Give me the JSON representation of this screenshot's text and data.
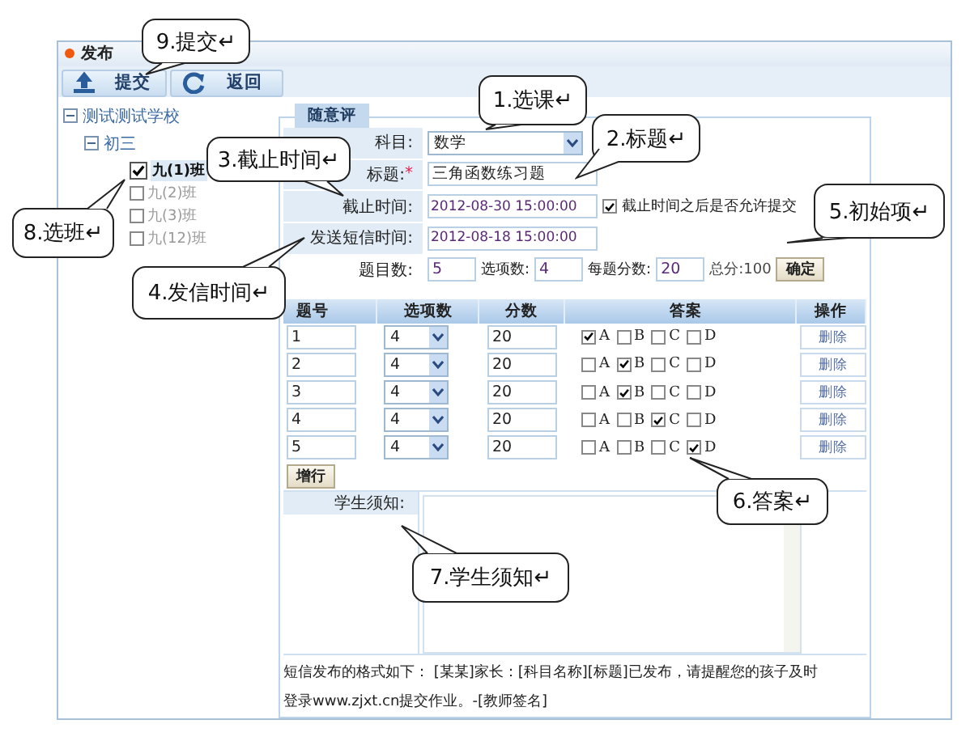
{
  "window": {
    "title": "发布"
  },
  "toolbar": [
    {
      "kind": "upload",
      "label": "提交"
    },
    {
      "kind": "back",
      "label": "返回"
    }
  ],
  "tree": {
    "label": "测试测试学校",
    "expanded": true,
    "children": [
      {
        "label": "初三",
        "expanded": true,
        "children": [
          {
            "label": "九(1)班",
            "checked": true
          },
          {
            "label": "九(2)班",
            "checked": false
          },
          {
            "label": "九(3)班",
            "checked": false
          },
          {
            "label": "九(12)班",
            "checked": false
          }
        ]
      }
    ]
  },
  "form": {
    "tab": "随意评",
    "subject": {
      "label": "科目:",
      "value": "数学"
    },
    "title": {
      "label": "标题:",
      "required_mark": "*",
      "value": "三角函数练习题"
    },
    "deadline": {
      "label": "截止时间:",
      "value": "2012-08-30 15:00:00"
    },
    "allow_late": {
      "label": "截止时间之后是否允许提交",
      "checked": true
    },
    "sms_time": {
      "label": "发送短信时间:",
      "value": "2012-08-18 15:00:00"
    },
    "counts": {
      "label": "题目数:",
      "value": "5",
      "options_label": "选项数:",
      "options_value": "4",
      "score_label": "每题分数:",
      "score_value": "20",
      "total": "总分:100",
      "confirm": "确定"
    }
  },
  "table": {
    "columns": [
      "题号",
      "选项数",
      "分数",
      "答案",
      "操作"
    ],
    "rows": [
      {
        "number": "1",
        "options": "4",
        "score": "20",
        "answers": [
          {
            "letter": "A",
            "checked": true
          },
          {
            "letter": "B",
            "checked": false
          },
          {
            "letter": "C",
            "checked": false
          },
          {
            "letter": "D",
            "checked": false
          }
        ],
        "action": "删除"
      },
      {
        "number": "2",
        "options": "4",
        "score": "20",
        "answers": [
          {
            "letter": "A",
            "checked": false
          },
          {
            "letter": "B",
            "checked": true
          },
          {
            "letter": "C",
            "checked": false
          },
          {
            "letter": "D",
            "checked": false
          }
        ],
        "action": "删除"
      },
      {
        "number": "3",
        "options": "4",
        "score": "20",
        "answers": [
          {
            "letter": "A",
            "checked": false
          },
          {
            "letter": "B",
            "checked": true
          },
          {
            "letter": "C",
            "checked": false
          },
          {
            "letter": "D",
            "checked": false
          }
        ],
        "action": "删除"
      },
      {
        "number": "4",
        "options": "4",
        "score": "20",
        "answers": [
          {
            "letter": "A",
            "checked": false
          },
          {
            "letter": "B",
            "checked": false
          },
          {
            "letter": "C",
            "checked": true
          },
          {
            "letter": "D",
            "checked": false
          }
        ],
        "action": "删除"
      },
      {
        "number": "5",
        "options": "4",
        "score": "20",
        "answers": [
          {
            "letter": "A",
            "checked": false
          },
          {
            "letter": "B",
            "checked": false
          },
          {
            "letter": "C",
            "checked": false
          },
          {
            "letter": "D",
            "checked": true
          }
        ],
        "action": "删除"
      }
    ],
    "add_row": "增行"
  },
  "notice": {
    "label": "学生须知:"
  },
  "sms_format": "短信发布的格式如下：   [某某]家长：[科目名称][标题]已发布，请提醒您的孩子及时登录www.zjxt.cn提交作业。-[教师签名]",
  "callouts": [
    {
      "text": "9.提交↵"
    },
    {
      "text": "1.选课↵"
    },
    {
      "text": "2.标题↵"
    },
    {
      "text": "3.截止时间↵"
    },
    {
      "text": "5.初始项↵"
    },
    {
      "text": "8.选班↵"
    },
    {
      "text": "4.发信时间↵"
    },
    {
      "text": "6.答案↵"
    },
    {
      "text": "7.学生须知↵"
    }
  ]
}
